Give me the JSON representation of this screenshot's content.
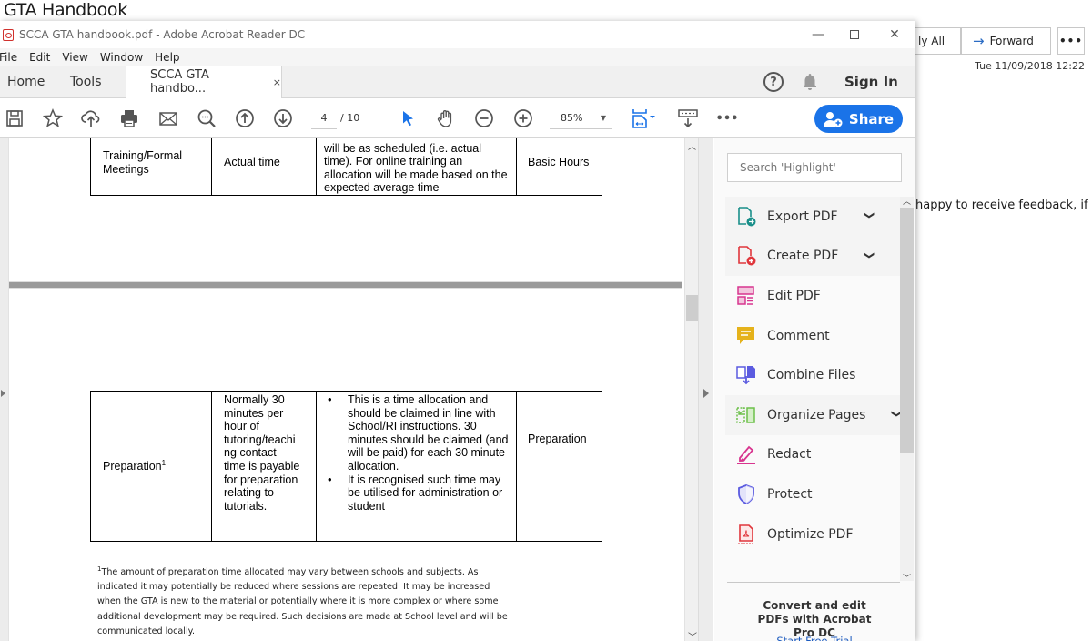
{
  "background_window": {
    "title": "GTA Handbook",
    "reply_all_label": "ly All",
    "forward_label": "Forward",
    "more_label": "•••",
    "date": "Tue 11/09/2018 12:22",
    "body_text_fragment": "happy to receive feedback, if"
  },
  "window": {
    "title": "SCCA GTA handbook.pdf - Adobe Acrobat Reader DC",
    "minimize": "—",
    "close": "✕"
  },
  "menu": [
    "File",
    "Edit",
    "View",
    "Window",
    "Help"
  ],
  "tabs": {
    "home": "Home",
    "tools": "Tools",
    "document": "SCCA GTA handbo...",
    "close": "×",
    "help": "?",
    "sign_in": "Sign In"
  },
  "toolbar": {
    "icons": [
      "save-icon",
      "bookmark-star-icon",
      "upload-cloud-icon",
      "print-icon",
      "email-icon",
      "search-zoom-icon",
      "page-up-icon",
      "page-down-icon",
      "select-cursor-icon",
      "hand-tool-icon",
      "zoom-out-icon",
      "zoom-in-icon",
      "fit-page-icon",
      "scroll-mode-icon",
      "more-icon"
    ],
    "current_page": "4",
    "total_pages": "/ 10",
    "zoom": "85%",
    "more": "•••",
    "share_label": "Share",
    "accent_color": "#1a73e8"
  },
  "document": {
    "table1": {
      "activity": "Training/Formal Meetings",
      "payable": "Actual time",
      "details": "will be as scheduled (i.e. actual time). For online training an allocation will be made based on the expected average time",
      "category": "Basic Hours"
    },
    "table2": {
      "activity": "Preparation",
      "activity_sup": "1",
      "payable": "Normally 30 minutes per hour of tutoring/teaching contact time is payable for preparation relating to tutorials.",
      "payable_lines": [
        "Normally 30",
        "minutes per",
        "hour of",
        "tutoring/teachi",
        "ng contact",
        "time is payable",
        "for preparation",
        "relating to",
        "tutorials."
      ],
      "details": [
        "This is a time allocation and should be claimed in line with School/RI instructions. 30 minutes should be claimed (and will be paid) for each 30 minute allocation.",
        "It is recognised such time may be utilised for administration or student"
      ],
      "category": "Preparation"
    },
    "footnote_marker": "1",
    "footnote": "The amount of preparation time allocated may vary between schools and subjects. As indicated it may potentially be reduced where sessions are repeated. It may be increased when the GTA is new to the material or potentially where it is more complex or where some additional development may be required. Such decisions are made at School level and will be communicated locally."
  },
  "tools_pane": {
    "search_placeholder": "Search 'Highlight'",
    "items": [
      {
        "label": "Export PDF",
        "icon": "export-pdf-icon",
        "color": "#1a8f8a",
        "expandable": true
      },
      {
        "label": "Create PDF",
        "icon": "create-pdf-icon",
        "color": "#e0363c",
        "expandable": true
      },
      {
        "label": "Edit PDF",
        "icon": "edit-pdf-icon",
        "color": "#d8358f",
        "expandable": false
      },
      {
        "label": "Comment",
        "icon": "comment-icon",
        "color": "#e5b21b",
        "expandable": false
      },
      {
        "label": "Combine Files",
        "icon": "combine-files-icon",
        "color": "#5b5be0",
        "expandable": false
      },
      {
        "label": "Organize Pages",
        "icon": "organize-pages-icon",
        "color": "#6cc04a",
        "expandable": true
      },
      {
        "label": "Redact",
        "icon": "redact-icon",
        "color": "#d8358f",
        "expandable": false
      },
      {
        "label": "Protect",
        "icon": "protect-icon",
        "color": "#5b5be0",
        "expandable": false
      },
      {
        "label": "Optimize PDF",
        "icon": "optimize-pdf-icon",
        "color": "#e0363c",
        "expandable": false
      }
    ],
    "promo": "Convert and edit PDFs with Acrobat Pro DC",
    "trial_link": "Start Free Trial"
  }
}
